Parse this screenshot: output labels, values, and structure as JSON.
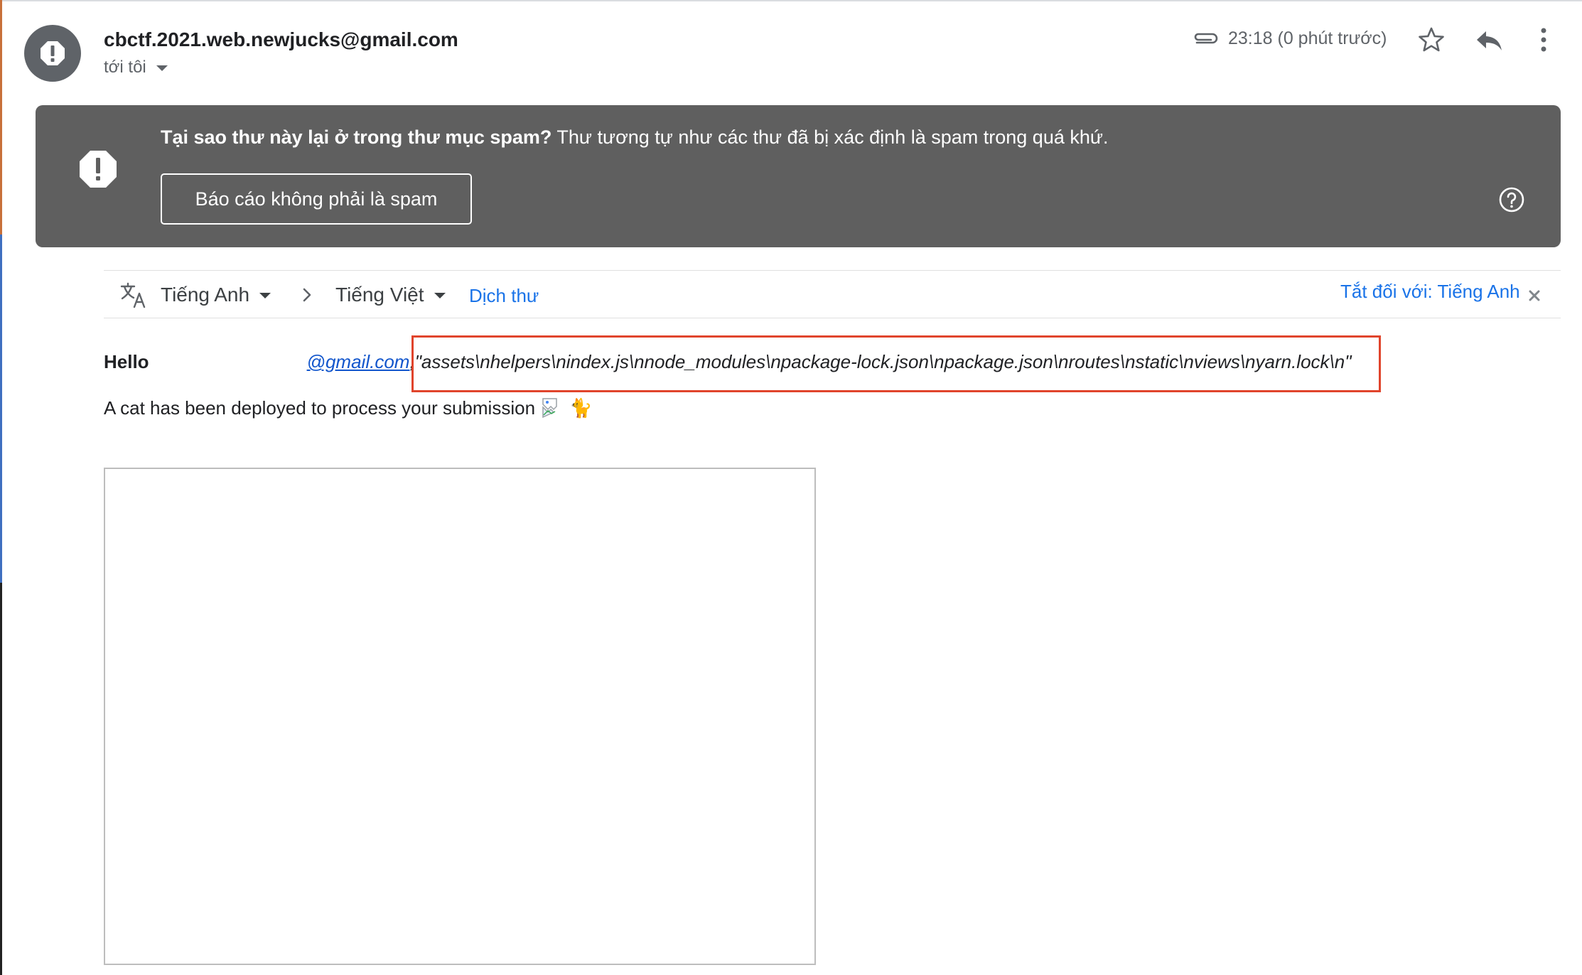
{
  "sender": {
    "email": "cbctf.2021.web.newjucks@gmail.com",
    "recipient_label": "tới tôi"
  },
  "header": {
    "timestamp": "23:18 (0 phút trước)",
    "icons": [
      "attachment-icon",
      "star-icon",
      "reply-icon",
      "more-vert-icon"
    ]
  },
  "spam_banner": {
    "question": "Tại sao thư này lại ở trong thư mục spam?",
    "explanation": " Thư tương tự như các thư đã bị xác định là spam trong quá khứ.",
    "button_label": "Báo cáo không phải là spam"
  },
  "translate_bar": {
    "source_language": "Tiếng Anh",
    "target_language": "Tiếng Việt",
    "translate_label": "Dịch thư",
    "turn_off_label": "Tắt đối với: Tiếng Anh"
  },
  "body": {
    "greeting": "Hello",
    "email_link": "@gmail.com",
    "separator": ",",
    "payload": "\"assets\\nhelpers\\nindex.js\\nnode_modules\\npackage-lock.json\\npackage.json\\nroutes\\nstatic\\nviews\\nyarn.lock\\n\"",
    "cat_text": "A cat has been deployed to process your submission",
    "cat_emoji": "🐈"
  },
  "colors": {
    "banner_bg": "#5f5f5f",
    "link": "#1a73e8",
    "highlight": "#e0442c"
  }
}
